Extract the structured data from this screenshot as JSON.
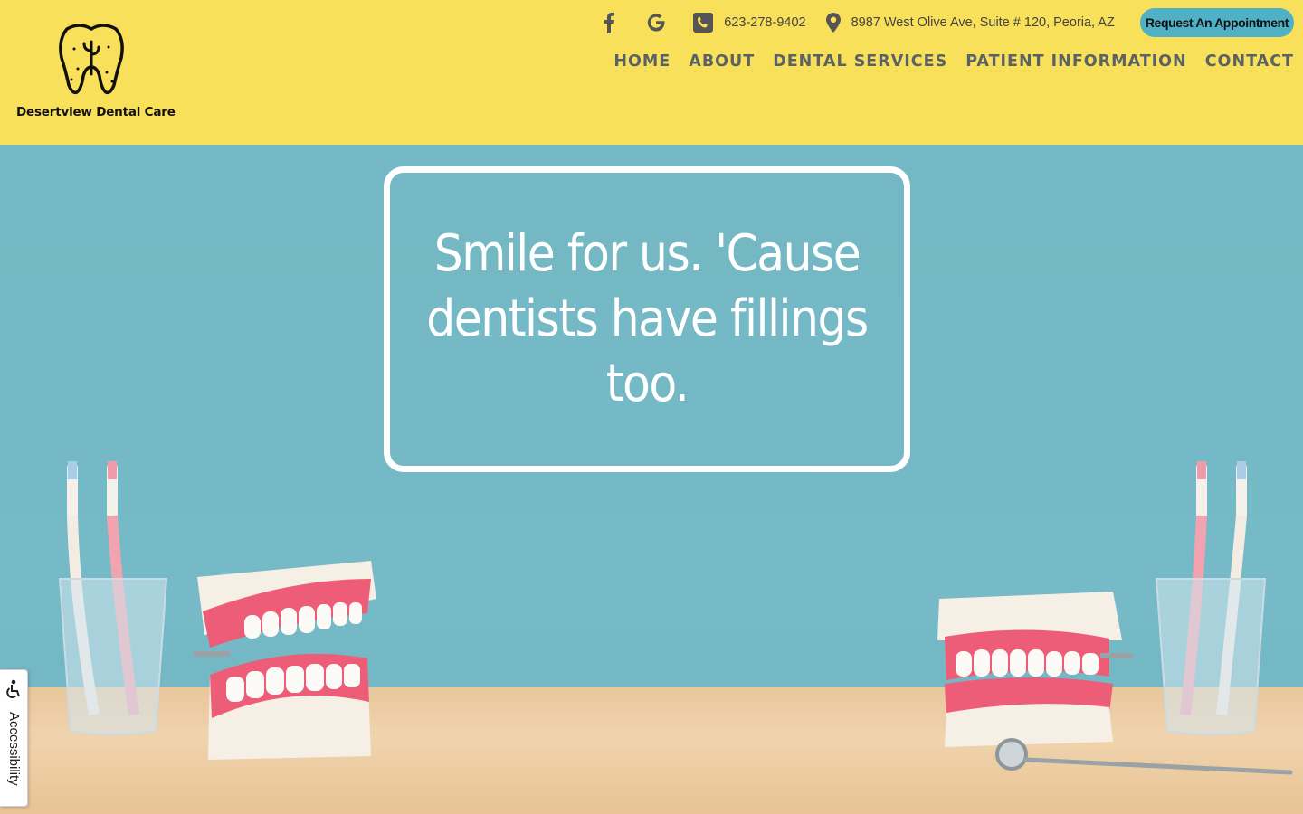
{
  "brand": {
    "name": "Desertview Dental Care",
    "logo_icon": "tooth-cactus-icon"
  },
  "topbar": {
    "social": [
      {
        "name": "facebook-icon"
      },
      {
        "name": "google-icon"
      }
    ],
    "phone": "623-278-9402",
    "address": "8987 West Olive Ave, Suite # 120, Peoria, AZ",
    "appointment_label": "Request An Appointment"
  },
  "nav": {
    "items": [
      "HOME",
      "ABOUT",
      "DENTAL SERVICES",
      "PATIENT INFORMATION",
      "CONTACT"
    ]
  },
  "hero": {
    "quote": "Smile for us. 'Cause dentists have fillings too."
  },
  "accessibility": {
    "label": "Accessibility",
    "icon": "accessibility-icon"
  },
  "colors": {
    "header_bg": "#f9e05b",
    "hero_bg": "#74b9c5",
    "accent": "#4fb1c6",
    "nav_text": "#5a6266"
  }
}
